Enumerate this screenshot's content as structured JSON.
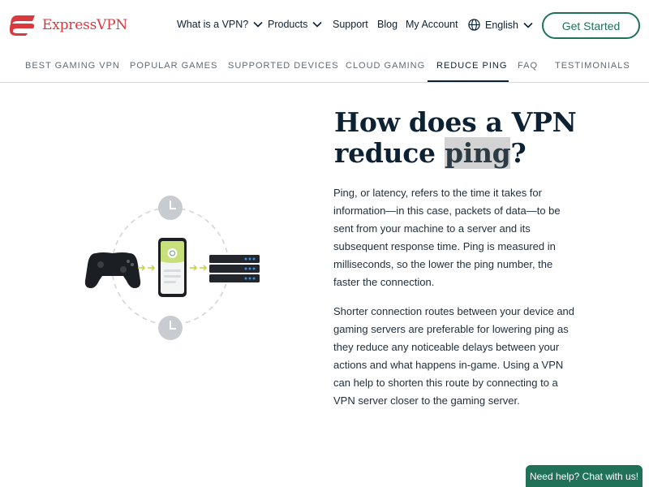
{
  "header": {
    "brand": "ExpressVPN",
    "brand_color": "#DA3940",
    "nav": {
      "what_is_vpn": "What is a VPN?",
      "products": "Products",
      "support": "Support",
      "blog": "Blog",
      "my_account": "My Account",
      "language": "English"
    },
    "cta_label": "Get Started",
    "accent_color": "#1F7258"
  },
  "subnav": {
    "items": [
      "BEST GAMING VPN",
      "POPULAR GAMES",
      "SUPPORTED DEVICES",
      "CLOUD GAMING",
      "REDUCE PING",
      "FAQ",
      "TESTIMONIALS"
    ],
    "active": "REDUCE PING"
  },
  "main": {
    "headline_before": "How does a VPN reduce ",
    "headline_highlight": "ping",
    "headline_after": "?",
    "paragraph1": "Ping, or latency, refers to the time it takes for information—in this case, packets of data—to be sent from your machine to a server and its subsequent response time. Ping is measured in milliseconds, so the lower the ping number, the faster the connection.",
    "paragraph2": "Shorter connection routes between your device and gaming servers are preferable for lowering ping as they reduce any noticeable delays between your actions and what happens in-game. Using a VPN can help to shorten this route by connecting to a VPN server closer to the gaming server.",
    "illustration_icons": [
      "clock-icon",
      "gamepad-icon",
      "phone-vpn-icon",
      "server-icon",
      "arrow-icon"
    ]
  },
  "chat": {
    "label": "Need help? Chat with us!"
  }
}
